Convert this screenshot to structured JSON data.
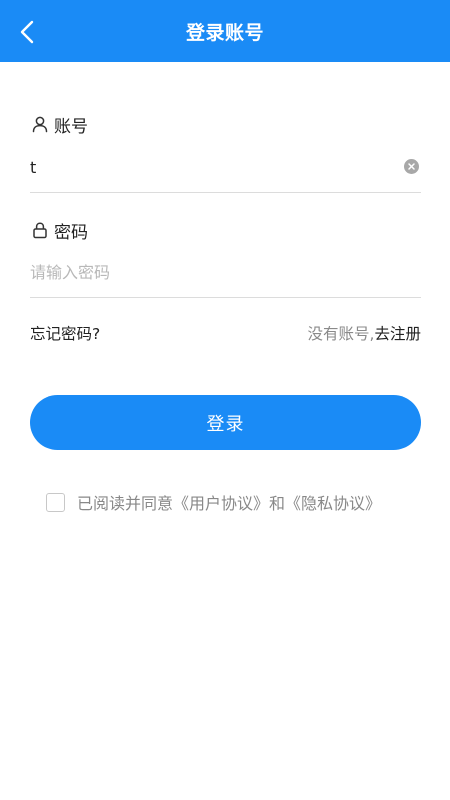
{
  "header": {
    "title": "登录账号"
  },
  "account": {
    "label": "账号",
    "value": "t",
    "placeholder": ""
  },
  "password": {
    "label": "密码",
    "value": "",
    "placeholder": "请输入密码"
  },
  "links": {
    "forgot": "忘记密码?",
    "no_account": "没有账号,",
    "register": "去注册"
  },
  "login_button": "登录",
  "agreement": {
    "checked": false,
    "prefix": "已阅读并同意",
    "user_agreement": "《用户协议》",
    "and": "和",
    "privacy_policy": "《隐私协议》"
  },
  "colors": {
    "primary": "#1a8bf6",
    "text": "#222222",
    "muted": "#888888",
    "divider": "#dcdcdc"
  },
  "icons": {
    "back": "chevron-left-icon",
    "account": "user-icon",
    "password": "lock-icon",
    "clear": "clear-icon"
  }
}
